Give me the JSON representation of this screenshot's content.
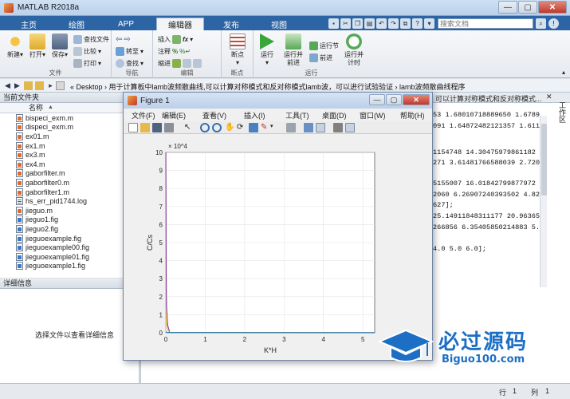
{
  "window": {
    "title": "MATLAB R2018a"
  },
  "tabs": [
    {
      "label": "主页"
    },
    {
      "label": "绘图"
    },
    {
      "label": "APP"
    },
    {
      "label": "编辑器"
    },
    {
      "label": "发布"
    },
    {
      "label": "视图"
    }
  ],
  "search": {
    "placeholder": "搜索文档"
  },
  "ribbon": {
    "file": {
      "label": "文件",
      "new": "新建",
      "open": "打开",
      "save": "保存",
      "find_files": "查找文件",
      "compare": "比较",
      "print": "打印"
    },
    "navigate": {
      "label": "导航",
      "insert": "插入",
      "comment": "注释",
      "indent": "缩进",
      "goto": "转至",
      "find": "查找"
    },
    "edit": {
      "label": "编辑"
    },
    "breakpoints": {
      "label": "断点",
      "breakpoint": "断点"
    },
    "run": {
      "label": "运行",
      "run": "运行",
      "run_advance": "运行并\n前进",
      "run_section": "运行节",
      "advance": "前进",
      "run_time": "运行并\n计时"
    }
  },
  "address": {
    "crumbs": "« Desktop  ›  用于计算板中lamb波频散曲线,可以计算对称模式和反对称模式lamb波，可以进行试验验证  ›  lamb波频散曲线程序"
  },
  "current_folder": {
    "title": "当前文件夹",
    "column_name": "名称",
    "files": [
      {
        "name": "bispeci_exm.m",
        "type": "m"
      },
      {
        "name": "dispeci_exm.m",
        "type": "m"
      },
      {
        "name": "ex01.m",
        "type": "m"
      },
      {
        "name": "ex1.m",
        "type": "m"
      },
      {
        "name": "ex3.m",
        "type": "m"
      },
      {
        "name": "ex4.m",
        "type": "m"
      },
      {
        "name": "gaborfilter.m",
        "type": "m"
      },
      {
        "name": "gaborfilter0.m",
        "type": "m"
      },
      {
        "name": "gaborfilter1.m",
        "type": "m"
      },
      {
        "name": "hs_err_pid1744.log",
        "type": "log"
      },
      {
        "name": "jieguo.m",
        "type": "m"
      },
      {
        "name": "jieguo1.fig",
        "type": "fig"
      },
      {
        "name": "jieguo2.fig",
        "type": "fig"
      },
      {
        "name": "jieguoexample.fig",
        "type": "fig"
      },
      {
        "name": "jieguoexample00.fig",
        "type": "fig"
      },
      {
        "name": "jieguoexample01.fig",
        "type": "fig"
      },
      {
        "name": "jieguoexample1.fig",
        "type": "fig"
      }
    ]
  },
  "details": {
    "title": "详细信息",
    "message": "选择文件以查看详细信息"
  },
  "editor": {
    "header": "可以计算对称模式和反对称模式...",
    "code_lines": [
      "53 1.68010718889650 1.6789",
      "091 1.64872482121357 1.6115",
      "",
      "1154748 14.30475979861182 1",
      "271 3.61481766588039 2.7207",
      "",
      "5155007 16.01842799877972 1",
      "2060 6.26907240393502 4.821",
      "627];",
      "25.14911848311177 20.963652",
      "266856 6.35405850214883 5.1",
      "",
      "4.0 5.0 6.0];"
    ]
  },
  "side_panel": {
    "label": "工作区"
  },
  "status": {
    "row_label": "行",
    "row": "1",
    "col_label": "列",
    "col": "1"
  },
  "figure": {
    "title": "Figure 1",
    "menu": [
      {
        "label": "文件(F)"
      },
      {
        "label": "编辑(E)"
      },
      {
        "label": "查看(V)"
      },
      {
        "label": "插入(I)"
      },
      {
        "label": "工具(T)"
      },
      {
        "label": "桌面(D)"
      },
      {
        "label": "窗口(W)"
      },
      {
        "label": "帮助(H)"
      }
    ]
  },
  "chart_data": {
    "type": "line",
    "xlabel": "K*H",
    "ylabel": "C/Cs",
    "y_exponent": "× 10^4",
    "xlim": [
      0,
      5.3
    ],
    "ylim": [
      0,
      10
    ],
    "xticks": [
      0,
      1,
      2,
      3,
      4,
      5
    ],
    "yticks": [
      0,
      1,
      2,
      3,
      4,
      5,
      6,
      7,
      8,
      9,
      10
    ],
    "grid": true,
    "series": [
      {
        "color": "#7e2f8e",
        "x": [
          0.001,
          0.005,
          0.01,
          0.02,
          0.05,
          0.1,
          5.3
        ],
        "y": [
          10,
          7.5,
          3.2,
          1.4,
          0.4,
          0.02,
          0.005
        ]
      },
      {
        "color": "#edb120",
        "x": [
          0.001,
          0.01,
          0.05,
          0.1,
          5.3
        ],
        "y": [
          1.2,
          0.6,
          0.15,
          0.02,
          0.005
        ]
      },
      {
        "color": "#0072bd",
        "x": [
          0.001,
          0.05,
          0.1,
          5.3
        ],
        "y": [
          0.05,
          0.02,
          0.01,
          0.005
        ]
      }
    ]
  },
  "watermark": {
    "text": "必过源码",
    "sub": "Biguo100.com"
  }
}
